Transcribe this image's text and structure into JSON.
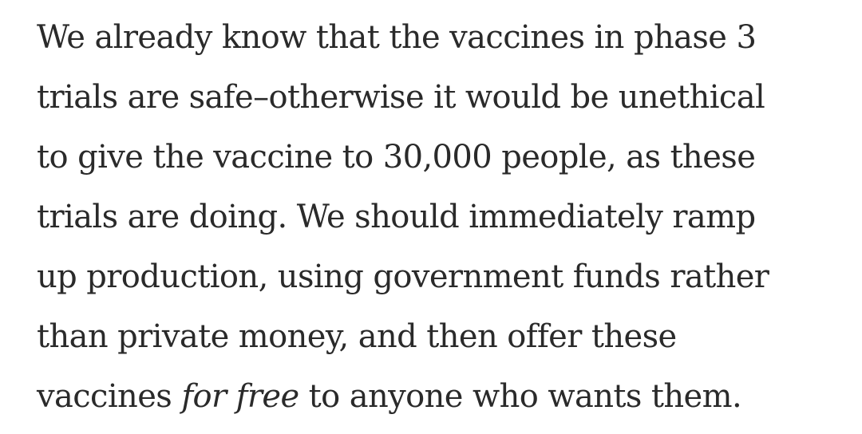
{
  "article": {
    "lines": [
      "We already know that the vaccines in phase 3",
      "trials are safe–otherwise it would be unethical",
      "to give the vaccine to 30,000 people, as these",
      "trials are doing. We should immediately ramp",
      "up production, using government funds rather",
      "than private money, and then offer these"
    ],
    "last_line": {
      "before": "vaccines ",
      "emphasis": "for free",
      "after": " to anyone who wants them."
    }
  }
}
